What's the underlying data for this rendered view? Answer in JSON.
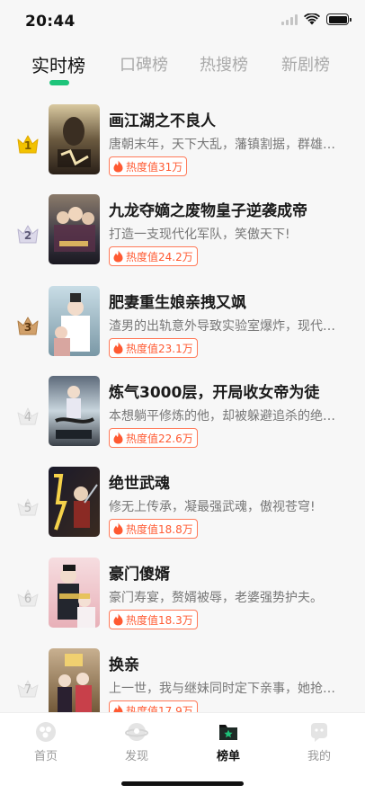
{
  "status_bar": {
    "time": "20:44"
  },
  "tabs": [
    {
      "label": "实时榜",
      "active": true
    },
    {
      "label": "口碑榜",
      "active": false
    },
    {
      "label": "热搜榜",
      "active": false
    },
    {
      "label": "新剧榜",
      "active": false
    }
  ],
  "list": {
    "items": [
      {
        "rank": "1",
        "title": "画江湖之不良人",
        "description": "唐朝末年，天下大乱，藩镇割据，群雄…",
        "heat": "热度值31万"
      },
      {
        "rank": "2",
        "title": "九龙夺嫡之废物皇子逆袭成帝",
        "description": "打造一支现代化军队，笑傲天下!",
        "heat": "热度值24.2万"
      },
      {
        "rank": "3",
        "title": "肥妻重生娘亲拽又飒",
        "description": "渣男的出轨意外导致实验室爆炸，现代…",
        "heat": "热度值23.1万"
      },
      {
        "rank": "4",
        "title": "炼气3000层，开局收女帝为徒",
        "description": "本想躺平修炼的他，却被躲避追杀的绝…",
        "heat": "热度值22.6万"
      },
      {
        "rank": "5",
        "title": "绝世武魂",
        "description": "修无上传承，凝最强武魂，傲视苍穹!",
        "heat": "热度值18.8万"
      },
      {
        "rank": "6",
        "title": "豪门傻婿",
        "description": "豪门寿宴，赘婿被辱，老婆强势护夫。",
        "heat": "热度值18.3万"
      },
      {
        "rank": "7",
        "title": "换亲",
        "description": "上一世，我与继妹同时定下亲事，她抢…",
        "heat": "热度值17.9万"
      }
    ]
  },
  "bottom_nav": [
    {
      "label": "首页",
      "icon": "home-icon",
      "active": false
    },
    {
      "label": "发现",
      "icon": "discover-icon",
      "active": false
    },
    {
      "label": "榜单",
      "icon": "ranking-icon",
      "active": true
    },
    {
      "label": "我的",
      "icon": "profile-icon",
      "active": false
    }
  ],
  "colors": {
    "accent": "#1ec47a",
    "heat": "#ff5a32",
    "gold": "#f2c200",
    "silver": "#c9c6dc",
    "bronze": "#c9935a"
  }
}
